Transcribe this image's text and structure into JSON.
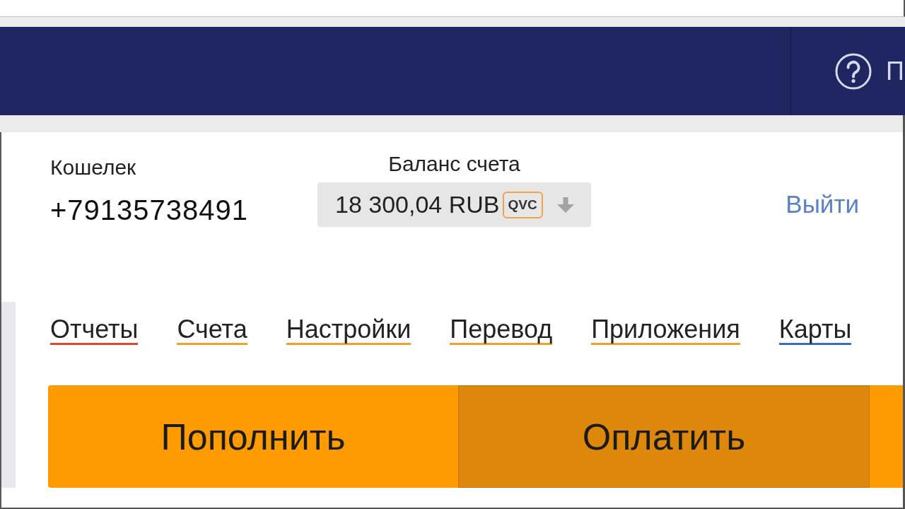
{
  "header": {
    "help_label": "П"
  },
  "account": {
    "wallet_label": "Кошелек",
    "wallet_number": "+79135738491",
    "balance_label": "Баланс счета",
    "balance": "18 300,04 RUB",
    "card_badge": "QVC",
    "logout": "Выйти"
  },
  "nav": [
    {
      "label": "Отчеты",
      "color": "#e8452c"
    },
    {
      "label": "Счета",
      "color": "#f3a02a"
    },
    {
      "label": "Настройки",
      "color": "#f3a02a"
    },
    {
      "label": "Перевод",
      "color": "#f3a02a"
    },
    {
      "label": "Приложения",
      "color": "#f3a02a"
    },
    {
      "label": "Карты",
      "color": "#3a6cc0"
    }
  ],
  "actions": [
    {
      "label": "Пополнить",
      "hovered": false
    },
    {
      "label": "Оплатить",
      "hovered": true
    },
    {
      "hovered": false
    }
  ]
}
